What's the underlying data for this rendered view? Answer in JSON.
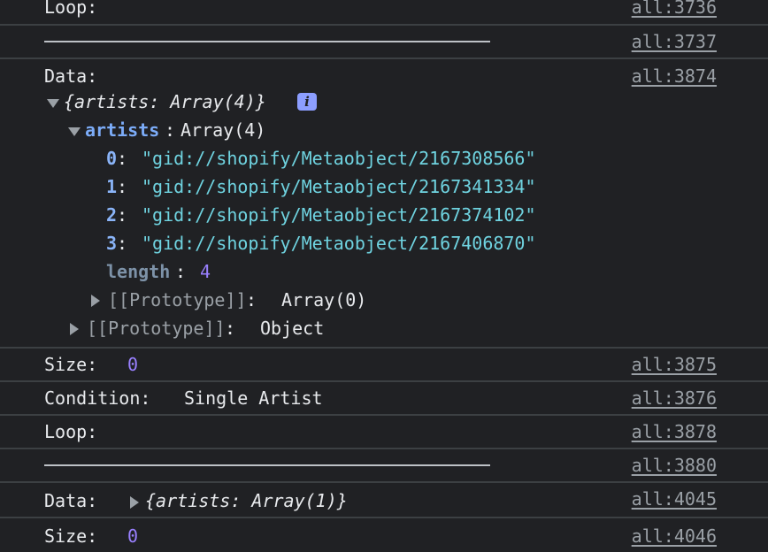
{
  "rows": [
    {
      "label": "Loop:",
      "source": "all:3736"
    },
    {
      "source": "all:3737"
    },
    {
      "label": "Data:",
      "source": "all:3874"
    },
    {
      "label": "Size:",
      "value": "0",
      "source": "all:3875"
    },
    {
      "label": "Condition:",
      "value": "Single Artist",
      "source": "all:3876"
    },
    {
      "label": "Loop:",
      "source": "all:3878"
    },
    {
      "source": "all:3880"
    },
    {
      "label": "Data:",
      "preview": "{artists: Array(1)}",
      "source": "all:4045"
    },
    {
      "label": "Size:",
      "value": "0",
      "source": "all:4046"
    }
  ],
  "tree": {
    "root_preview": "{artists: Array(4)}",
    "info_badge": "i",
    "artists_key": "artists",
    "artists_type": "Array(4)",
    "items": [
      {
        "index": "0",
        "value": "\"gid://shopify/Metaobject/2167308566\""
      },
      {
        "index": "1",
        "value": "\"gid://shopify/Metaobject/2167341334\""
      },
      {
        "index": "2",
        "value": "\"gid://shopify/Metaobject/2167374102\""
      },
      {
        "index": "3",
        "value": "\"gid://shopify/Metaobject/2167406870\""
      }
    ],
    "length_key": "length",
    "length_value": "4",
    "array_proto_key": "[[Prototype]]",
    "array_proto_value": "Array(0)",
    "object_proto_key": "[[Prototype]]",
    "object_proto_value": "Object"
  },
  "colors": {
    "background": "#202124",
    "border": "#3c4043",
    "string": "#6fd3e0",
    "number": "#9980ff",
    "key": "#7cacf8"
  }
}
